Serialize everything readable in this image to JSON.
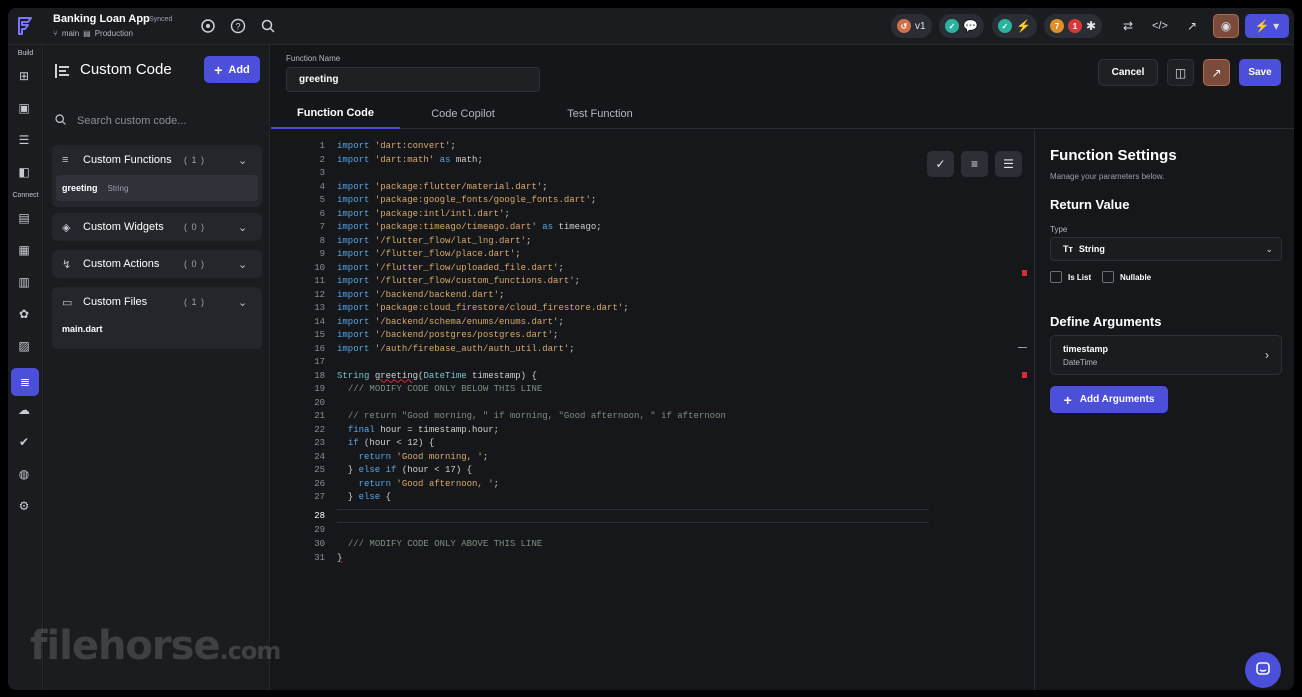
{
  "topbar": {
    "app_title": "Banking Loan App",
    "sync_status": "Synced",
    "branch": "main",
    "environment": "Production",
    "version": "v1",
    "avatar_count_1": "7",
    "avatar_count_2": "1"
  },
  "rail": {
    "build_label": "Build",
    "connect_label": "Connect"
  },
  "explorer": {
    "title": "Custom Code",
    "add_label": "Add",
    "search_placeholder": "Search custom code...",
    "groups": [
      {
        "label": "Custom Functions",
        "count": "( 1 )"
      },
      {
        "label": "Custom Widgets",
        "count": "( 0 )"
      },
      {
        "label": "Custom Actions",
        "count": "( 0 )"
      },
      {
        "label": "Custom Files",
        "count": "( 1 )"
      }
    ],
    "function_item": {
      "name": "greeting",
      "type": "String"
    },
    "file_item": "main.dart"
  },
  "header": {
    "function_name_label": "Function Name",
    "function_name_value": "greeting",
    "cancel_label": "Cancel",
    "save_label": "Save"
  },
  "tabs": [
    "Function Code",
    "Code Copilot",
    "Test Function"
  ],
  "code": {
    "line_numbers": [
      "1",
      "2",
      "3",
      "4",
      "5",
      "6",
      "7",
      "8",
      "9",
      "10",
      "11",
      "12",
      "13",
      "14",
      "15",
      "16",
      "17",
      "18",
      "19",
      "20",
      "21",
      "22",
      "23",
      "24",
      "25",
      "26",
      "27",
      "28",
      "29",
      "30",
      "31"
    ],
    "current_line": "28"
  },
  "settings": {
    "title": "Function Settings",
    "subtitle": "Manage your parameters below.",
    "return_value_heading": "Return Value",
    "type_label": "Type",
    "type_value": "String",
    "is_list_label": "Is List",
    "nullable_label": "Nullable",
    "define_arguments_heading": "Define Arguments",
    "argument": {
      "name": "timestamp",
      "type": "DateTime"
    },
    "add_arguments_label": "Add Arguments"
  },
  "watermark": {
    "main": "filehorse",
    "suffix": ".com"
  },
  "colors": {
    "accent": "#4b4fd9",
    "background": "#14161a",
    "panel": "#1a1c20"
  }
}
